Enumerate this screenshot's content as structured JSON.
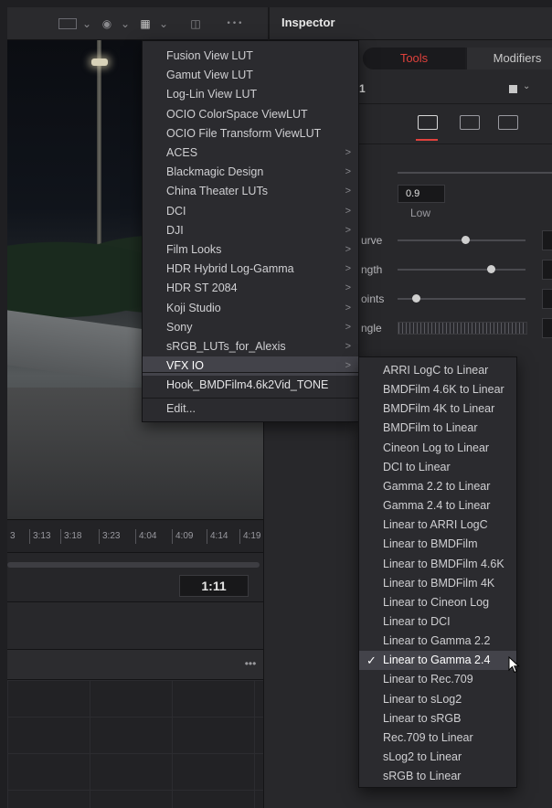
{
  "toolbar": {
    "icons": [
      "viewer-mode-icon",
      "chevron-down-icon",
      "color-wheel-icon",
      "chevron-down-icon",
      "grid-icon",
      "chevron-down-icon",
      "split-view-icon",
      "more-icon"
    ],
    "more_glyph": "•••",
    "inspector_title": "Inspector"
  },
  "inspector": {
    "tabs": {
      "tools": "Tools",
      "modifiers": "Modifiers"
    },
    "node_number": "1",
    "low_value": "0.9",
    "low_label": "Low",
    "labels": [
      "urve",
      "ngth",
      "oints",
      "ngle"
    ],
    "tools_tab_color": "#e0413c"
  },
  "timeline": {
    "ticks": [
      "3",
      "3:13",
      "3:18",
      "3:23",
      "4:04",
      "4:09",
      "4:14",
      "4:19"
    ],
    "timecode": "1:11",
    "more_glyph": "•••"
  },
  "lut_menu": {
    "items": [
      {
        "label": "Fusion View LUT",
        "submenu": false
      },
      {
        "label": "Gamut View LUT",
        "submenu": false
      },
      {
        "label": "Log-Lin View LUT",
        "submenu": false
      },
      {
        "label": "OCIO ColorSpace ViewLUT",
        "submenu": false
      },
      {
        "label": "OCIO File Transform ViewLUT",
        "submenu": false
      },
      {
        "label": "ACES",
        "submenu": true
      },
      {
        "label": "Blackmagic Design",
        "submenu": true
      },
      {
        "label": "China Theater LUTs",
        "submenu": true
      },
      {
        "label": "DCI",
        "submenu": true
      },
      {
        "label": "DJI",
        "submenu": true
      },
      {
        "label": "Film Looks",
        "submenu": true
      },
      {
        "label": "HDR Hybrid Log-Gamma",
        "submenu": true
      },
      {
        "label": "HDR ST 2084",
        "submenu": true
      },
      {
        "label": "Koji Studio",
        "submenu": true
      },
      {
        "label": "Sony",
        "submenu": true
      },
      {
        "label": "sRGB_LUTs_for_Alexis",
        "submenu": true
      },
      {
        "label": "VFX IO",
        "submenu": true,
        "highlighted": true
      }
    ],
    "extra_item": "Hook_BMDFilm4.6k2Vid_TONE",
    "edit_item": "Edit...",
    "arrow_glyph": ">"
  },
  "vfx_submenu": {
    "items": [
      "ARRI LogC to Linear",
      "BMDFilm 4.6K to Linear",
      "BMDFilm 4K to Linear",
      "BMDFilm to Linear",
      "Cineon Log to Linear",
      "DCI to Linear",
      "Gamma 2.2 to Linear",
      "Gamma 2.4 to Linear",
      "Linear to ARRI LogC",
      "Linear to BMDFilm",
      "Linear to BMDFilm 4.6K",
      "Linear to BMDFilm 4K",
      "Linear to Cineon Log",
      "Linear to DCI",
      "Linear to Gamma 2.2",
      "Linear to Gamma 2.4",
      "Linear to Rec.709",
      "Linear to sLog2",
      "Linear to sRGB",
      "Rec.709 to Linear",
      "sLog2 to Linear",
      "sRGB to Linear"
    ],
    "checked_index": 15,
    "check_glyph": "✓"
  }
}
